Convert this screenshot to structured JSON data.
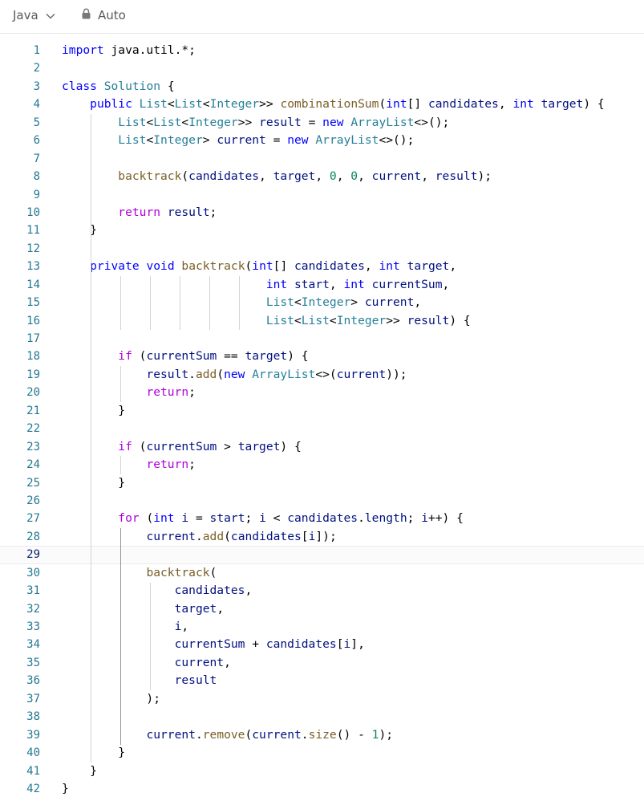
{
  "toolbar": {
    "language": "Java",
    "language_icon": "chevron-down-icon",
    "access_icon": "lock-icon",
    "access_mode": "Auto"
  },
  "editor": {
    "language": "java",
    "current_line": 29,
    "lines": [
      {
        "n": "1",
        "html": "<span class='k'>import</span> java.util.*;"
      },
      {
        "n": "2",
        "html": ""
      },
      {
        "n": "3",
        "html": "<span class='k'>class</span> <span class='t'>Solution</span> {"
      },
      {
        "n": "4",
        "html": "    <span class='k'>public</span> <span class='t'>List</span>&lt;<span class='t'>List</span>&lt;<span class='t'>Integer</span>&gt;&gt; <span class='f'>combinationSum</span>(<span class='k'>int</span>[] <span class='v'>candidates</span>, <span class='k'>int</span> <span class='v'>target</span>) {"
      },
      {
        "n": "5",
        "html": "        <span class='t'>List</span>&lt;<span class='t'>List</span>&lt;<span class='t'>Integer</span>&gt;&gt; <span class='v'>result</span> = <span class='k'>new</span> <span class='t'>ArrayList</span>&lt;&gt;();"
      },
      {
        "n": "6",
        "html": "        <span class='t'>List</span>&lt;<span class='t'>Integer</span>&gt; <span class='v'>current</span> = <span class='k'>new</span> <span class='t'>ArrayList</span>&lt;&gt;();"
      },
      {
        "n": "7",
        "html": ""
      },
      {
        "n": "8",
        "html": "        <span class='f'>backtrack</span>(<span class='v'>candidates</span>, <span class='v'>target</span>, <span class='n'>0</span>, <span class='n'>0</span>, <span class='v'>current</span>, <span class='v'>result</span>);"
      },
      {
        "n": "9",
        "html": ""
      },
      {
        "n": "10",
        "html": "        <span class='c'>return</span> <span class='v'>result</span>;"
      },
      {
        "n": "11",
        "html": "    }"
      },
      {
        "n": "12",
        "html": ""
      },
      {
        "n": "13",
        "html": "    <span class='k'>private</span> <span class='k'>void</span> <span class='f'>backtrack</span>(<span class='k'>int</span>[] <span class='v'>candidates</span>, <span class='k'>int</span> <span class='v'>target</span>,"
      },
      {
        "n": "14",
        "html": "                             <span class='k'>int</span> <span class='v'>start</span>, <span class='k'>int</span> <span class='v'>currentSum</span>,"
      },
      {
        "n": "15",
        "html": "                             <span class='t'>List</span>&lt;<span class='t'>Integer</span>&gt; <span class='v'>current</span>,"
      },
      {
        "n": "16",
        "html": "                             <span class='t'>List</span>&lt;<span class='t'>List</span>&lt;<span class='t'>Integer</span>&gt;&gt; <span class='v'>result</span>) {"
      },
      {
        "n": "17",
        "html": ""
      },
      {
        "n": "18",
        "html": "        <span class='c'>if</span> (<span class='v'>currentSum</span> == <span class='v'>target</span>) {"
      },
      {
        "n": "19",
        "html": "            <span class='v'>result</span>.<span class='f'>add</span>(<span class='k'>new</span> <span class='t'>ArrayList</span>&lt;&gt;(<span class='v'>current</span>));"
      },
      {
        "n": "20",
        "html": "            <span class='c'>return</span>;"
      },
      {
        "n": "21",
        "html": "        }"
      },
      {
        "n": "22",
        "html": ""
      },
      {
        "n": "23",
        "html": "        <span class='c'>if</span> (<span class='v'>currentSum</span> &gt; <span class='v'>target</span>) {"
      },
      {
        "n": "24",
        "html": "            <span class='c'>return</span>;"
      },
      {
        "n": "25",
        "html": "        }"
      },
      {
        "n": "26",
        "html": ""
      },
      {
        "n": "27",
        "html": "        <span class='c'>for</span> (<span class='k'>int</span> <span class='v'>i</span> = <span class='v'>start</span>; <span class='v'>i</span> &lt; <span class='v'>candidates</span>.<span class='v'>length</span>; <span class='v'>i</span>++) {"
      },
      {
        "n": "28",
        "html": "            <span class='v'>current</span>.<span class='f'>add</span>(<span class='v'>candidates</span>[<span class='v'>i</span>]);"
      },
      {
        "n": "29",
        "html": ""
      },
      {
        "n": "30",
        "html": "            <span class='f'>backtrack</span>("
      },
      {
        "n": "31",
        "html": "                <span class='v'>candidates</span>,"
      },
      {
        "n": "32",
        "html": "                <span class='v'>target</span>,"
      },
      {
        "n": "33",
        "html": "                <span class='v'>i</span>,"
      },
      {
        "n": "34",
        "html": "                <span class='v'>currentSum</span> + <span class='v'>candidates</span>[<span class='v'>i</span>],"
      },
      {
        "n": "35",
        "html": "                <span class='v'>current</span>,"
      },
      {
        "n": "36",
        "html": "                <span class='v'>result</span>"
      },
      {
        "n": "37",
        "html": "            );"
      },
      {
        "n": "38",
        "html": ""
      },
      {
        "n": "39",
        "html": "            <span class='v'>current</span>.<span class='f'>remove</span>(<span class='v'>current</span>.<span class='f'>size</span>() - <span class='n'>1</span>);"
      },
      {
        "n": "40",
        "html": "        }"
      },
      {
        "n": "41",
        "html": "    }"
      },
      {
        "n": "42",
        "html": "}"
      }
    ]
  },
  "colors": {
    "keyword": "#0000ff",
    "control": "#af00db",
    "type": "#267f99",
    "variable": "#001080",
    "function": "#795e26",
    "number": "#098658",
    "line_number": "#237893",
    "indent_guide": "#d3d3d3"
  }
}
